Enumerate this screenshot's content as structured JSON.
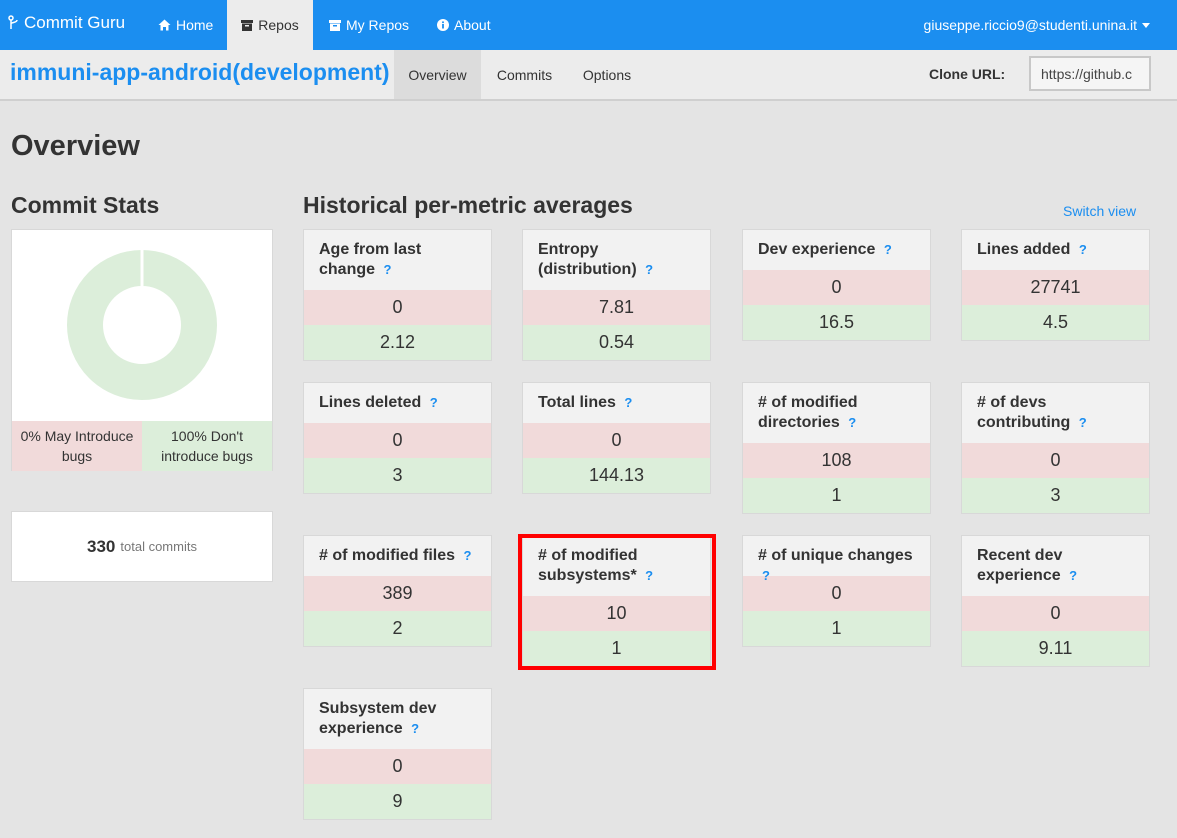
{
  "navbar": {
    "brand": "Commit Guru",
    "items": [
      {
        "label": "Home",
        "icon": "home-icon"
      },
      {
        "label": "Repos",
        "icon": "archive-icon"
      },
      {
        "label": "My Repos",
        "icon": "inbox-icon"
      },
      {
        "label": "About",
        "icon": "info-icon"
      }
    ],
    "user_email": "giuseppe.riccio9@studenti.unina.it"
  },
  "subheader": {
    "repo_name": "immuni-app-android(development)",
    "tabs": [
      {
        "label": "Overview",
        "active": true
      },
      {
        "label": "Commits",
        "active": false
      },
      {
        "label": "Options",
        "active": false
      }
    ],
    "clone_label": "Clone URL:",
    "clone_value": "https://github.c"
  },
  "page_title": "Overview",
  "commit_stats": {
    "heading": "Commit Stats",
    "donut": {
      "may_introduce_pct": 0,
      "dont_introduce_pct": 100,
      "colors": {
        "bug": "#f1dada",
        "clean": "#dceeda"
      }
    },
    "legend_bug": "0% May Introduce bugs",
    "legend_clean": "100% Don't introduce bugs",
    "total_count": "330",
    "total_label": "total commits"
  },
  "metrics": {
    "heading": "Historical per-metric averages",
    "switch_view": "Switch view",
    "help_glyph": "?",
    "cards": [
      {
        "title": "Age from last change",
        "bug": "0",
        "clean": "2.12"
      },
      {
        "title": "Entropy (distribution)",
        "bug": "7.81",
        "clean": "0.54"
      },
      {
        "title": "Dev experience",
        "bug": "0",
        "clean": "16.5"
      },
      {
        "title": "Lines added",
        "bug": "27741",
        "clean": "4.5"
      },
      {
        "title": "Lines deleted",
        "bug": "0",
        "clean": "3"
      },
      {
        "title": "Total lines",
        "bug": "0",
        "clean": "144.13"
      },
      {
        "title": "# of modified directories",
        "bug": "108",
        "clean": "1"
      },
      {
        "title": "# of devs contributing",
        "bug": "0",
        "clean": "3"
      },
      {
        "title": "# of modified files",
        "bug": "389",
        "clean": "2"
      },
      {
        "title": "# of modified subsystems*",
        "bug": "10",
        "clean": "1"
      },
      {
        "title": "# of unique changes",
        "bug": "0",
        "clean": "1"
      },
      {
        "title": "Recent dev experience",
        "bug": "0",
        "clean": "9.11"
      },
      {
        "title": "Subsystem dev experience",
        "bug": "0",
        "clean": "9"
      }
    ]
  }
}
